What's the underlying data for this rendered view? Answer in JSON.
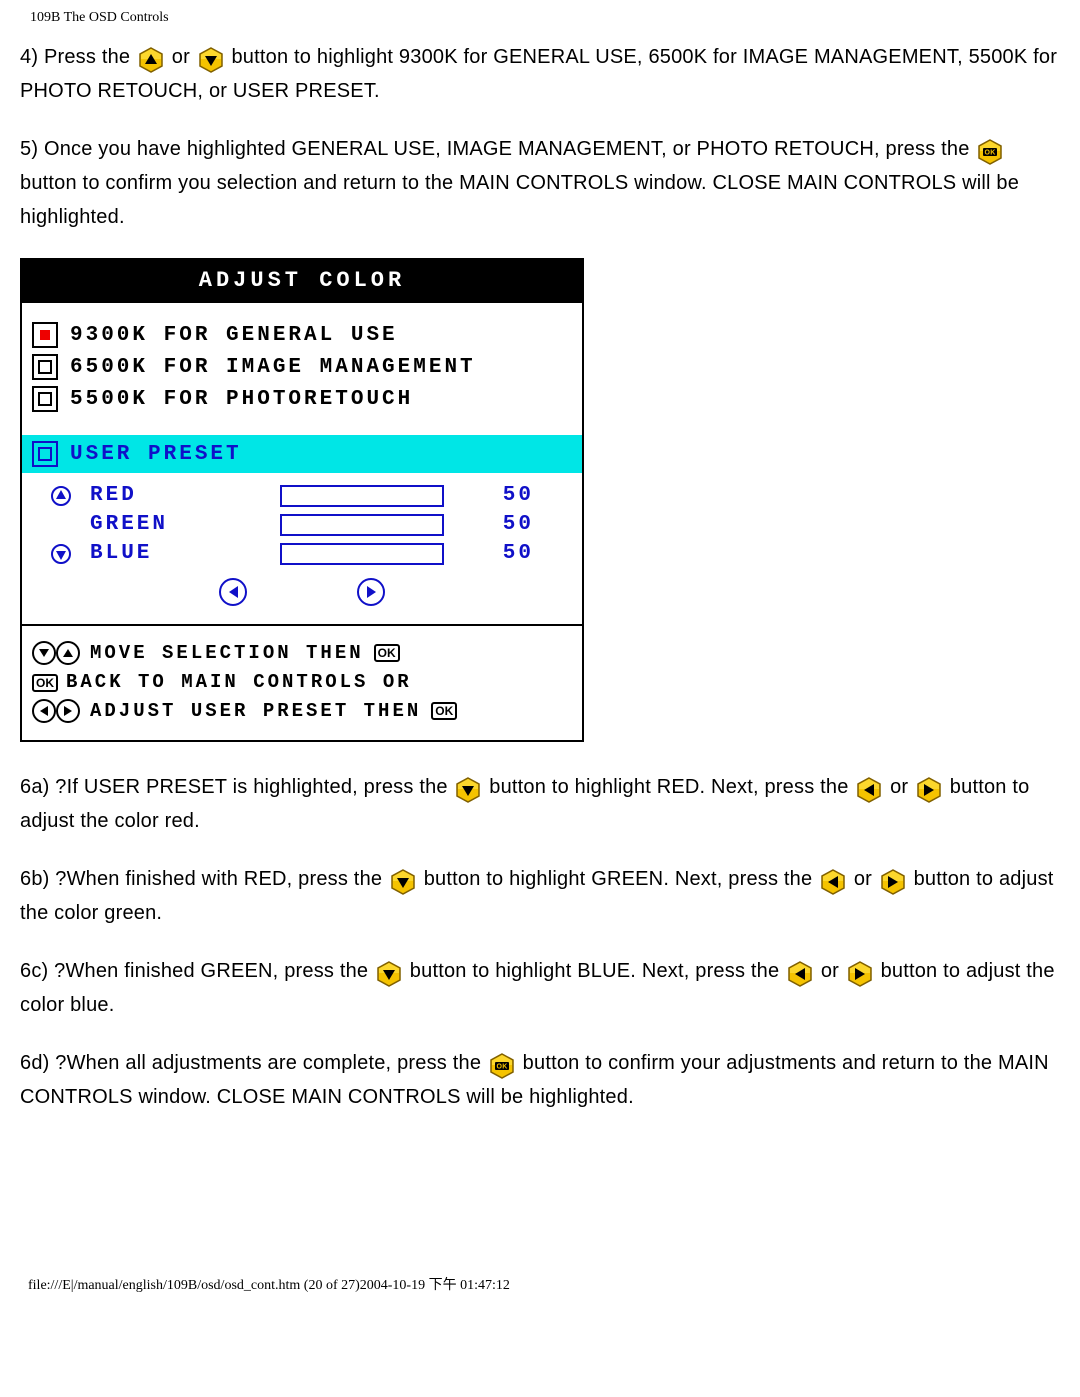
{
  "header": "109B The OSD Controls",
  "steps": {
    "s4a": "4) Press the ",
    "s4b": " or ",
    "s4c": " button to highlight 9300K for GENERAL USE, 6500K for IMAGE MANAGEMENT, 5500K for PHOTO RETOUCH, or USER PRESET.",
    "s5a": "5) Once you have highlighted GENERAL USE, IMAGE MANAGEMENT, or PHOTO RETOUCH, press the ",
    "s5b": " button to confirm you selection and return to the MAIN CONTROLS window. CLOSE MAIN CONTROLS will be highlighted.",
    "s6a1": "6a) ?If USER PRESET is highlighted, press the ",
    "s6a2": " button to highlight RED. Next, press the ",
    "s6a3": " or ",
    "s6a4": " button to adjust the color red.",
    "s6b1": "6b) ?When finished with RED, press the ",
    "s6b2": " button to highlight GREEN. Next, press the ",
    "s6b3": " or ",
    "s6b4": " button to adjust the color green.",
    "s6c1": "6c) ?When finished GREEN, press the ",
    "s6c2": " button to highlight BLUE. Next, press the ",
    "s6c3": " or ",
    "s6c4": " button to adjust the color blue.",
    "s6d1": "6d) ?When all adjustments are complete, press the ",
    "s6d2": " button to confirm your adjustments and return to the MAIN CONTROLS window. CLOSE MAIN CONTROLS will be highlighted."
  },
  "osd": {
    "title": "ADJUST COLOR",
    "presets": [
      {
        "label": "9300K FOR GENERAL USE",
        "selected": true
      },
      {
        "label": "6500K FOR IMAGE MANAGEMENT",
        "selected": false
      },
      {
        "label": "5500K FOR PHOTORETOUCH",
        "selected": false
      }
    ],
    "user_preset_label": "USER PRESET",
    "channels": [
      {
        "name": "RED",
        "value": 50,
        "icon": "up"
      },
      {
        "name": "GREEN",
        "value": 50,
        "icon": ""
      },
      {
        "name": "BLUE",
        "value": 50,
        "icon": "down"
      }
    ],
    "hints": {
      "h1": "MOVE SELECTION THEN",
      "h2": "BACK TO MAIN CONTROLS OR",
      "h3": "ADJUST USER PRESET THEN"
    },
    "ok_label": "OK"
  },
  "footer": "file:///E|/manual/english/109B/osd/osd_cont.htm (20 of 27)2004-10-19 下午 01:47:12"
}
